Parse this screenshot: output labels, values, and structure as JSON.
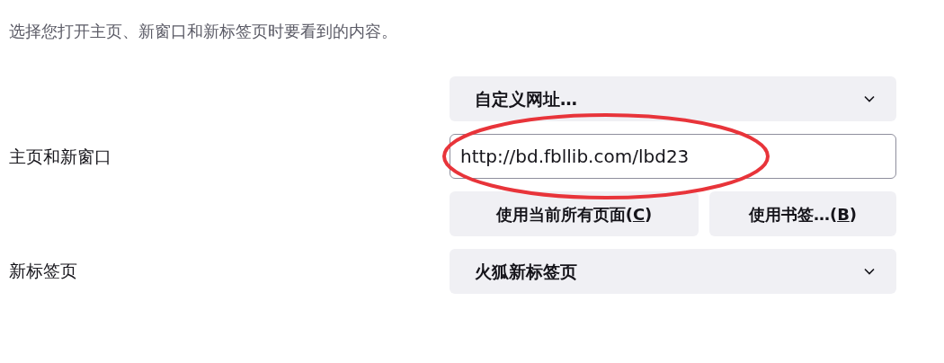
{
  "section": {
    "description": "选择您打开主页、新窗口和新标签页时要看到的内容。"
  },
  "homepage": {
    "label": "主页和新窗口",
    "dropdown": "自定义网址…",
    "url": "http://bd.fbllib.com/lbd23",
    "buttons": [
      {
        "before": "使用当前所有页面(",
        "key": "C",
        "after": ")"
      },
      {
        "before": "使用书签…(",
        "key": "B",
        "after": ")"
      }
    ]
  },
  "newtab": {
    "label": "新标签页",
    "dropdown": "火狐新标签页"
  },
  "annotation": {
    "kind": "ellipse",
    "color": "#e8343a"
  }
}
